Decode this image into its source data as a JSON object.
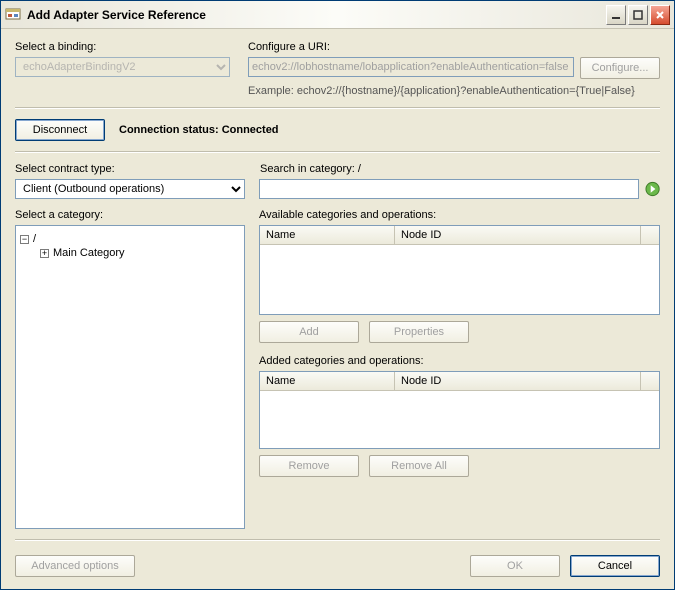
{
  "window": {
    "title": "Add Adapter Service Reference"
  },
  "binding": {
    "label": "Select a binding:",
    "value": "echoAdapterBindingV2"
  },
  "uri": {
    "label": "Configure a URI:",
    "value": "echov2://lobhostname/lobapplication?enableAuthentication=false",
    "configure_btn": "Configure...",
    "example": "Example: echov2://{hostname}/{application}?enableAuthentication={True|False}"
  },
  "connect": {
    "disconnect_btn": "Disconnect",
    "status_label": "Connection status:",
    "status_value": "Connected"
  },
  "contract": {
    "label": "Select contract type:",
    "value": "Client (Outbound operations)"
  },
  "search": {
    "label": "Search in category: /",
    "value": ""
  },
  "category": {
    "label": "Select a category:",
    "root": "/",
    "child": "Main Category"
  },
  "available": {
    "label": "Available categories and operations:",
    "col_name": "Name",
    "col_node": "Node ID",
    "add_btn": "Add",
    "props_btn": "Properties"
  },
  "added": {
    "label": "Added categories and operations:",
    "col_name": "Name",
    "col_node": "Node ID",
    "remove_btn": "Remove",
    "removeall_btn": "Remove All"
  },
  "footer": {
    "advanced_btn": "Advanced options",
    "ok_btn": "OK",
    "cancel_btn": "Cancel"
  }
}
